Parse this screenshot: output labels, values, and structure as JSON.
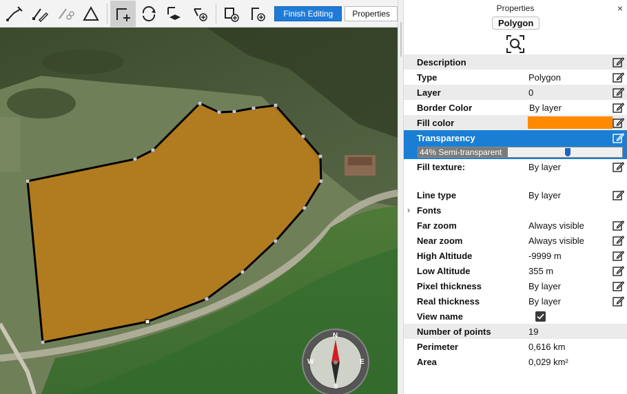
{
  "toolbar": {
    "tools": [
      {
        "name": "draw-polyline-tool-icon"
      },
      {
        "name": "edit-line-tool-icon"
      },
      {
        "name": "cut-line-tool-icon"
      },
      {
        "name": "edit-points-tool-icon"
      },
      {
        "name": "move-vertices-tool-icon",
        "active": true
      },
      {
        "name": "rotate-tool-icon"
      },
      {
        "name": "layer-tool-icon"
      },
      {
        "name": "add-vertex-tool-icon"
      },
      {
        "name": "add-shape-tool-icon"
      },
      {
        "name": "add-point-tool-icon"
      }
    ],
    "finish_label": "Finish Editing",
    "properties_label": "Properties"
  },
  "map": {
    "compass": {
      "n": "N",
      "e": "E",
      "s": "S",
      "w": "W"
    },
    "polygon_fill": "#c07a12",
    "polygon_stroke": "#000000"
  },
  "panel": {
    "title": "Properties",
    "close": "×",
    "object_type": "Polygon",
    "rows": {
      "description": {
        "label": "Description",
        "value": ""
      },
      "type": {
        "label": "Type",
        "value": "Polygon"
      },
      "layer": {
        "label": "Layer",
        "value": "0"
      },
      "border_color": {
        "label": "Border Color",
        "value": "By layer"
      },
      "fill_color": {
        "label": "Fill color",
        "value": "#ff8a00"
      },
      "transparency": {
        "label": "Transparency",
        "slider_text": "44% Semi-transparent",
        "percent": 44
      },
      "fill_texture": {
        "label": "Fill texture:",
        "value": "By layer"
      },
      "line_type": {
        "label": "Line type",
        "value": "By layer"
      },
      "fonts": {
        "label": "Fonts",
        "expander": "›"
      },
      "far_zoom": {
        "label": "Far zoom",
        "value": "Always visible"
      },
      "near_zoom": {
        "label": "Near zoom",
        "value": "Always visible"
      },
      "high_altitude": {
        "label": "High Altitude",
        "value": "-9999 m"
      },
      "low_altitude": {
        "label": "Low Altitude",
        "value": "355 m"
      },
      "pixel_thickness": {
        "label": "Pixel thickness",
        "value": "By layer"
      },
      "real_thickness": {
        "label": "Real thickness",
        "value": "By layer"
      },
      "view_name": {
        "label": "View name",
        "checked": true
      },
      "number_of_points": {
        "label": "Number of points",
        "value": "19"
      },
      "perimeter": {
        "label": "Perimeter",
        "value": "0,616 km"
      },
      "area": {
        "label": "Area",
        "value": "0,029 km²"
      }
    }
  }
}
